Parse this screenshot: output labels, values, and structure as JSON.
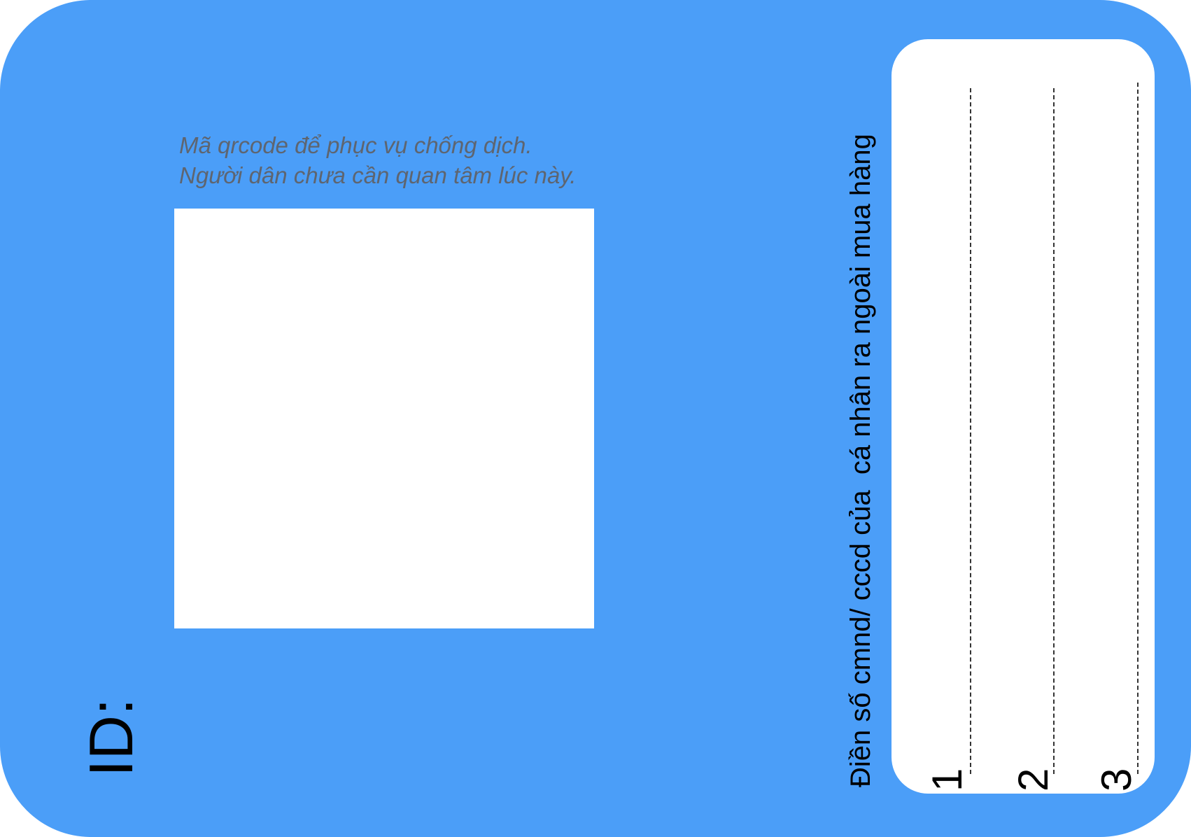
{
  "card": {
    "background_color": "#4b9ef8"
  },
  "qr_section": {
    "caption_line_1": "Mã qrcode để phục vụ chống dịch.",
    "caption_line_2": "Người dân chưa cần  quan tâm lúc này.",
    "caption_color": "#5e6570"
  },
  "id_label": "ID:",
  "id_entry": {
    "instruction": "Điền số cmnd/ cccd của  cá nhân ra ngoài mua hàng",
    "slots": [
      {
        "number": "1"
      },
      {
        "number": "2"
      },
      {
        "number": "3"
      }
    ]
  }
}
